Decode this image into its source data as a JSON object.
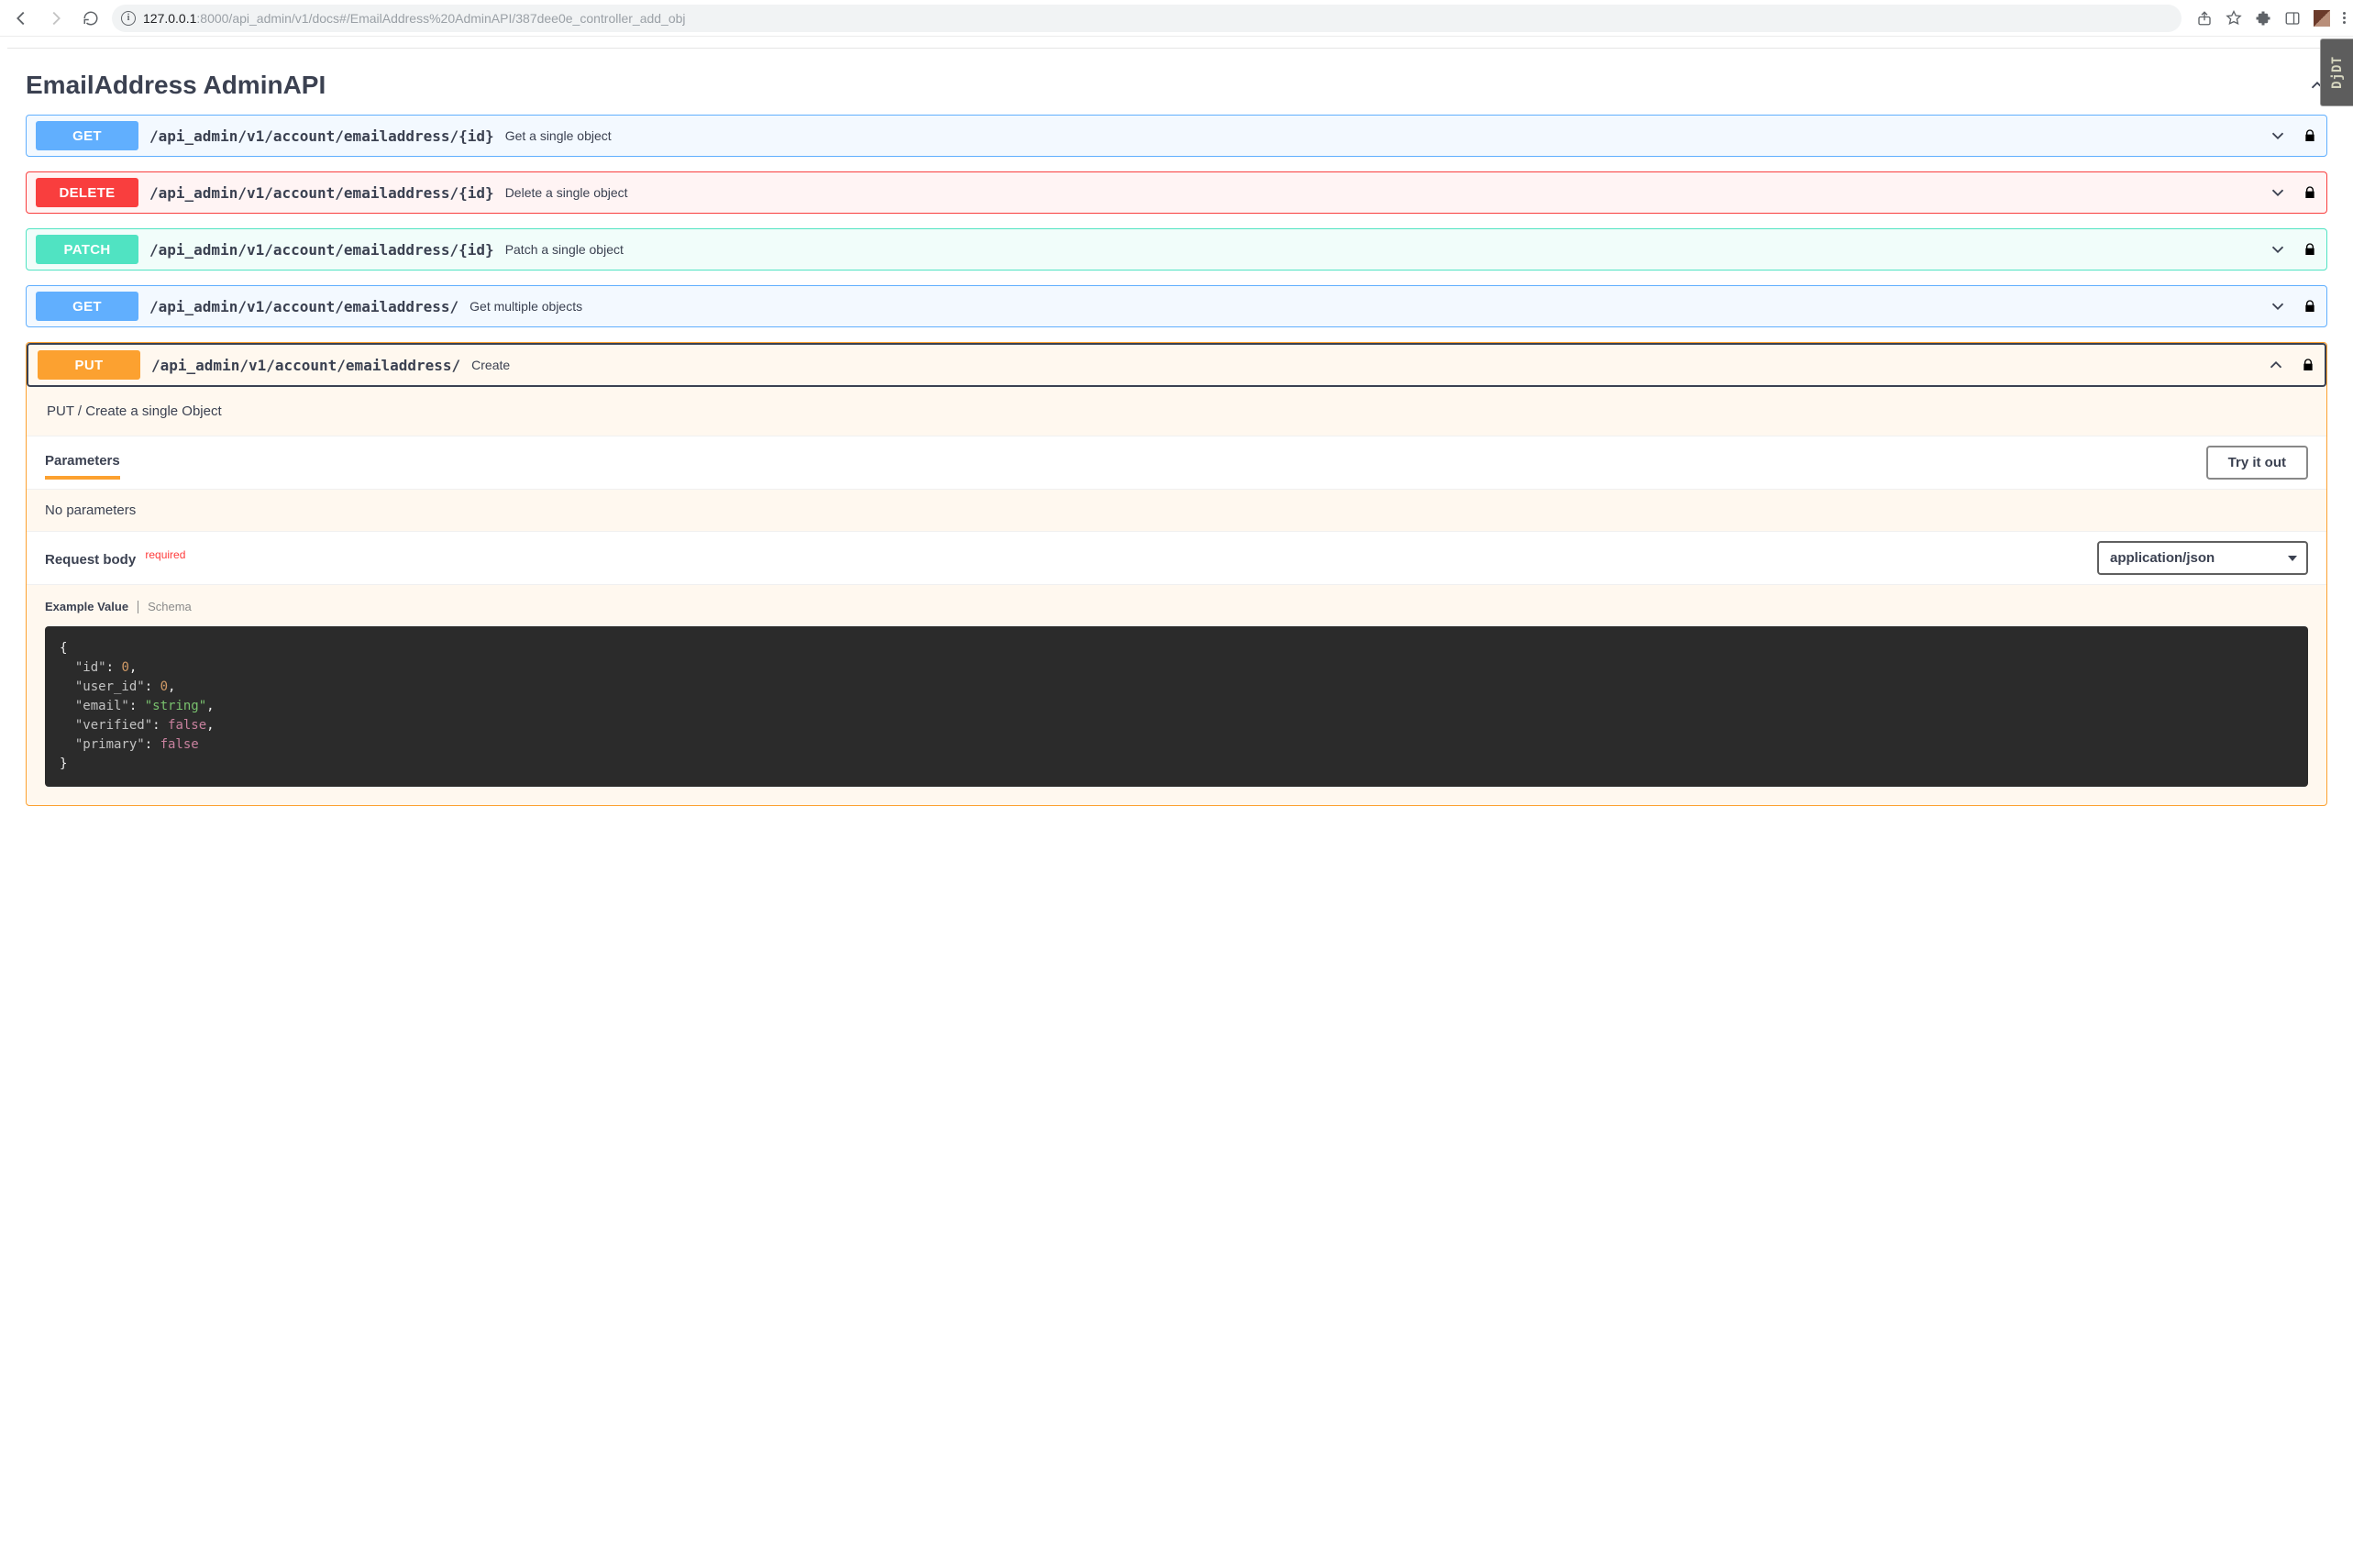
{
  "browser": {
    "url_host": "127.0.0.1",
    "url_port_path": ":8000/api_admin/v1/docs#/EmailAddress%20AdminAPI/387dee0e_controller_add_obj"
  },
  "djdt": {
    "label": "DjDT"
  },
  "section": {
    "title": "EmailAddress AdminAPI"
  },
  "ops": [
    {
      "method": "GET",
      "path": "/api_admin/v1/account/emailaddress/{id}",
      "desc": "Get a single object"
    },
    {
      "method": "DELETE",
      "path": "/api_admin/v1/account/emailaddress/{id}",
      "desc": "Delete a single object"
    },
    {
      "method": "PATCH",
      "path": "/api_admin/v1/account/emailaddress/{id}",
      "desc": "Patch a single object"
    },
    {
      "method": "GET",
      "path": "/api_admin/v1/account/emailaddress/",
      "desc": "Get multiple objects"
    }
  ],
  "put": {
    "method": "PUT",
    "path": "/api_admin/v1/account/emailaddress/",
    "desc": "Create",
    "full_desc": "PUT / Create a single Object",
    "params_heading": "Parameters",
    "tryout_label": "Try it out",
    "no_params": "No parameters",
    "reqbody_label": "Request body",
    "required_label": "required",
    "content_type": "application/json",
    "tab_example": "Example Value",
    "tab_schema": "Schema",
    "example_json": {
      "id": 0,
      "user_id": 0,
      "email": "string",
      "verified": false,
      "primary": false
    }
  }
}
